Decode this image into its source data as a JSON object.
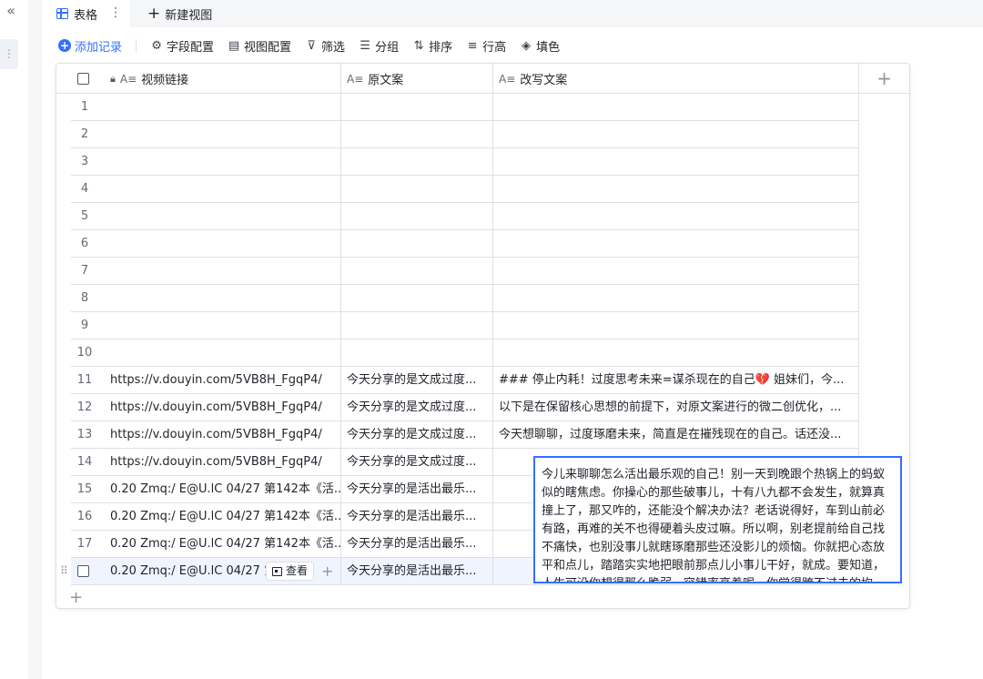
{
  "tabs": {
    "active_label": "表格",
    "new_view_label": "新建视图"
  },
  "toolbar": {
    "add_record": "添加记录",
    "field_config": "字段配置",
    "view_config": "视图配置",
    "filter": "筛选",
    "group": "分组",
    "sort": "排序",
    "row_height": "行高",
    "fill_color": "填色"
  },
  "columns": {
    "video_link": "视频链接",
    "original": "原文案",
    "rewritten": "改写文案"
  },
  "rows": [
    {
      "num": "1",
      "link": "",
      "original": "",
      "rewritten": ""
    },
    {
      "num": "2",
      "link": "",
      "original": "",
      "rewritten": ""
    },
    {
      "num": "3",
      "link": "",
      "original": "",
      "rewritten": ""
    },
    {
      "num": "4",
      "link": "",
      "original": "",
      "rewritten": ""
    },
    {
      "num": "5",
      "link": "",
      "original": "",
      "rewritten": ""
    },
    {
      "num": "6",
      "link": "",
      "original": "",
      "rewritten": ""
    },
    {
      "num": "7",
      "link": "",
      "original": "",
      "rewritten": ""
    },
    {
      "num": "8",
      "link": "",
      "original": "",
      "rewritten": ""
    },
    {
      "num": "9",
      "link": "",
      "original": "",
      "rewritten": ""
    },
    {
      "num": "10",
      "link": "",
      "original": "",
      "rewritten": ""
    },
    {
      "num": "11",
      "link": "https://v.douyin.com/5VB8H_FgqP4/",
      "original": "今天分享的是文成过度...",
      "rewritten": "### 停止内耗！过度思考未来=谋杀现在的自己💔 姐妹们，今..."
    },
    {
      "num": "12",
      "link": "https://v.douyin.com/5VB8H_FgqP4/",
      "original": "今天分享的是文成过度...",
      "rewritten": "以下是在保留核心思想的前提下，对原文案进行的微二创优化，..."
    },
    {
      "num": "13",
      "link": "https://v.douyin.com/5VB8H_FgqP4/",
      "original": "今天分享的是文成过度...",
      "rewritten": "今天想聊聊，过度琢磨未来，简直是在摧残现在的自己。话还没..."
    },
    {
      "num": "14",
      "link": "https://v.douyin.com/5VB8H_FgqP4/",
      "original": "今天分享的是文成过度...",
      "rewritten": ""
    },
    {
      "num": "15",
      "link": "0.20 Zmq:/ E@U.lC 04/27 第142本《活...",
      "original": "今天分享的是活出最乐...",
      "rewritten": ""
    },
    {
      "num": "16",
      "link": "0.20 Zmq:/ E@U.lC 04/27 第142本《活...",
      "original": "今天分享的是活出最乐...",
      "rewritten": ""
    },
    {
      "num": "17",
      "link": "0.20 Zmq:/ E@U.lC 04/27 第142本《活...",
      "original": "今天分享的是活出最乐...",
      "rewritten": ""
    }
  ],
  "selected_row": {
    "link": "0.20 Zmq:/ E@U.lC 04/27 第",
    "view_label": "查看",
    "original": "今天分享的是活出最乐..."
  },
  "editor": {
    "text": "今儿来聊聊怎么活出最乐观的自己！别一天到晚跟个热锅上的蚂蚁似的瞎焦虑。你操心的那些破事儿，十有八九都不会发生，就算真撞上了，那又咋的，还能没个解决办法？老话说得好，车到山前必有路，再难的关不也得硬着头皮过嘛。所以啊，别老提前给自己找不痛快，也别没事儿就瞎琢磨那些还没影儿的烦恼。你就把心态放平和点儿，踏踏实实地把眼前那点儿小事儿干好，就成。要知道，人生可没你想得那么脆弱，容错率高着呢。你觉得跨不过去的坎儿，说不定哪天在一个平平无奇的午后，就那么嘁嘁嘁地过去了。别"
  }
}
